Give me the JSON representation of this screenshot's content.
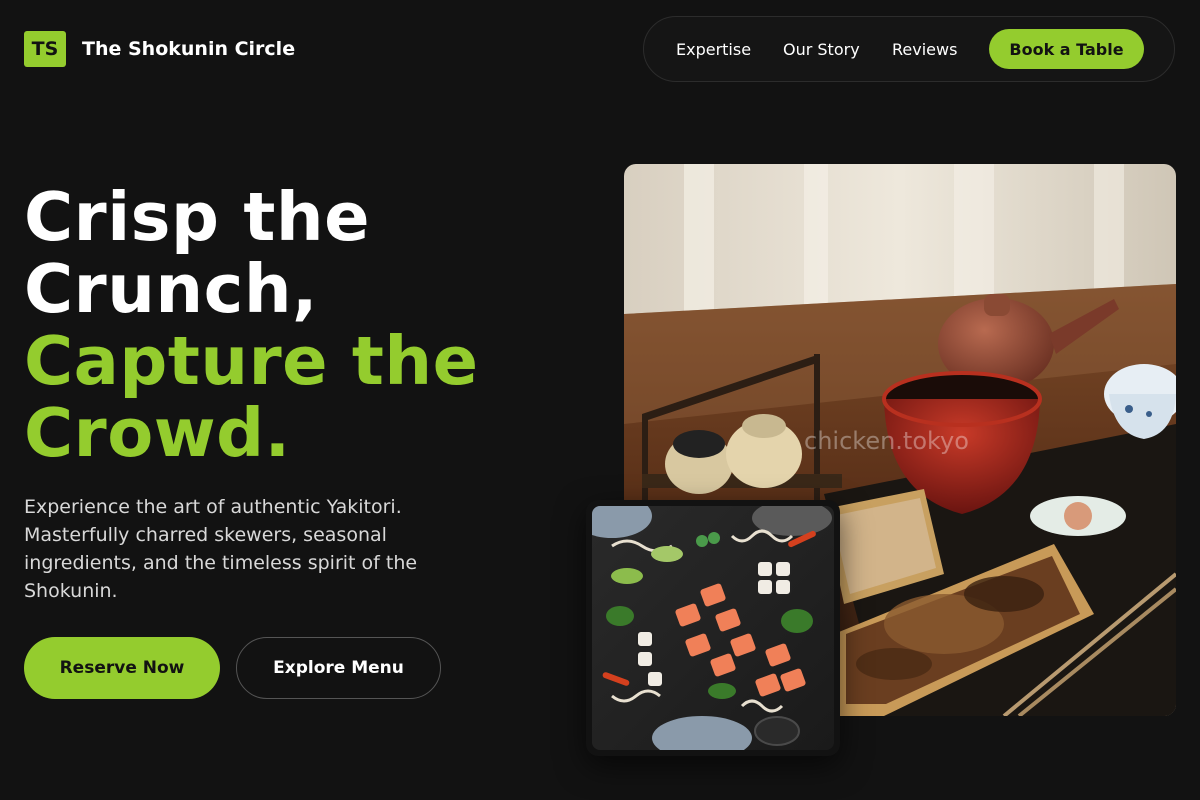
{
  "brand": {
    "badge": "TS",
    "name": "The Shokunin Circle"
  },
  "nav": {
    "links": [
      "Expertise",
      "Our Story",
      "Reviews"
    ],
    "cta": "Book a Table"
  },
  "hero": {
    "headline_white": [
      "Crisp the",
      "Crunch,"
    ],
    "headline_green": [
      "Capture the",
      "Crowd."
    ],
    "description": "Experience the art of authentic Yakitori. Masterfully charred skewers, seasonal ingredients, and the timeless spirit of the Shokunin.",
    "primary_button": "Reserve Now",
    "secondary_button": "Explore Menu"
  },
  "images": {
    "main_watermark": "chicken.tokyo"
  },
  "colors": {
    "accent": "#94cc2e",
    "background": "#121212"
  }
}
